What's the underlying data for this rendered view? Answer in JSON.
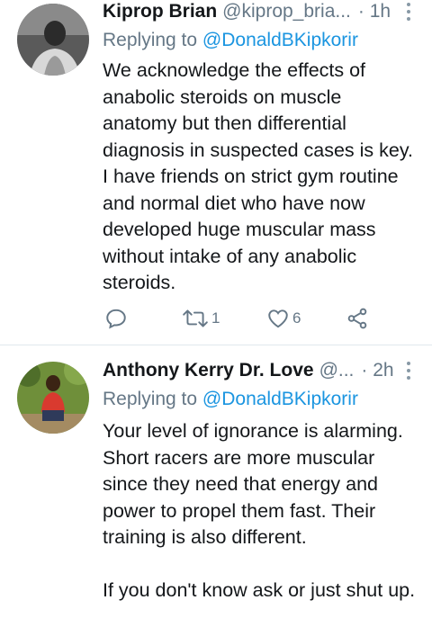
{
  "tweets": [
    {
      "author_name": "Kiprop Brian",
      "author_handle": "@kiprop_bria...",
      "time": "· 1h",
      "replying_prefix": "Replying to ",
      "replying_to": "@DonaldBKipkorir",
      "text": "We acknowledge the effects of anabolic steroids on muscle anatomy but then differential diagnosis in suspected cases is key. I have friends on strict gym routine and normal diet who have now developed huge muscular mass without intake of any anabolic steroids.",
      "retweet_count": "1",
      "like_count": "6"
    },
    {
      "author_name": "Anthony Kerry Dr. Love",
      "author_handle": "@...",
      "time": "· 2h",
      "replying_prefix": "Replying to ",
      "replying_to": "@DonaldBKipkorir",
      "text": "Your level of ignorance is alarming. Short racers are more muscular since they need that energy and power to propel them fast. Their training is also different.\n\nIf you don't know ask or just shut up."
    }
  ],
  "icons": [
    "reply-icon",
    "retweet-icon",
    "like-icon",
    "share-icon",
    "more-options-icon"
  ],
  "colors": {
    "link": "#1b95e0",
    "secondary_text": "#657786",
    "primary_text": "#14171a",
    "divider": "#e1e8ed"
  }
}
